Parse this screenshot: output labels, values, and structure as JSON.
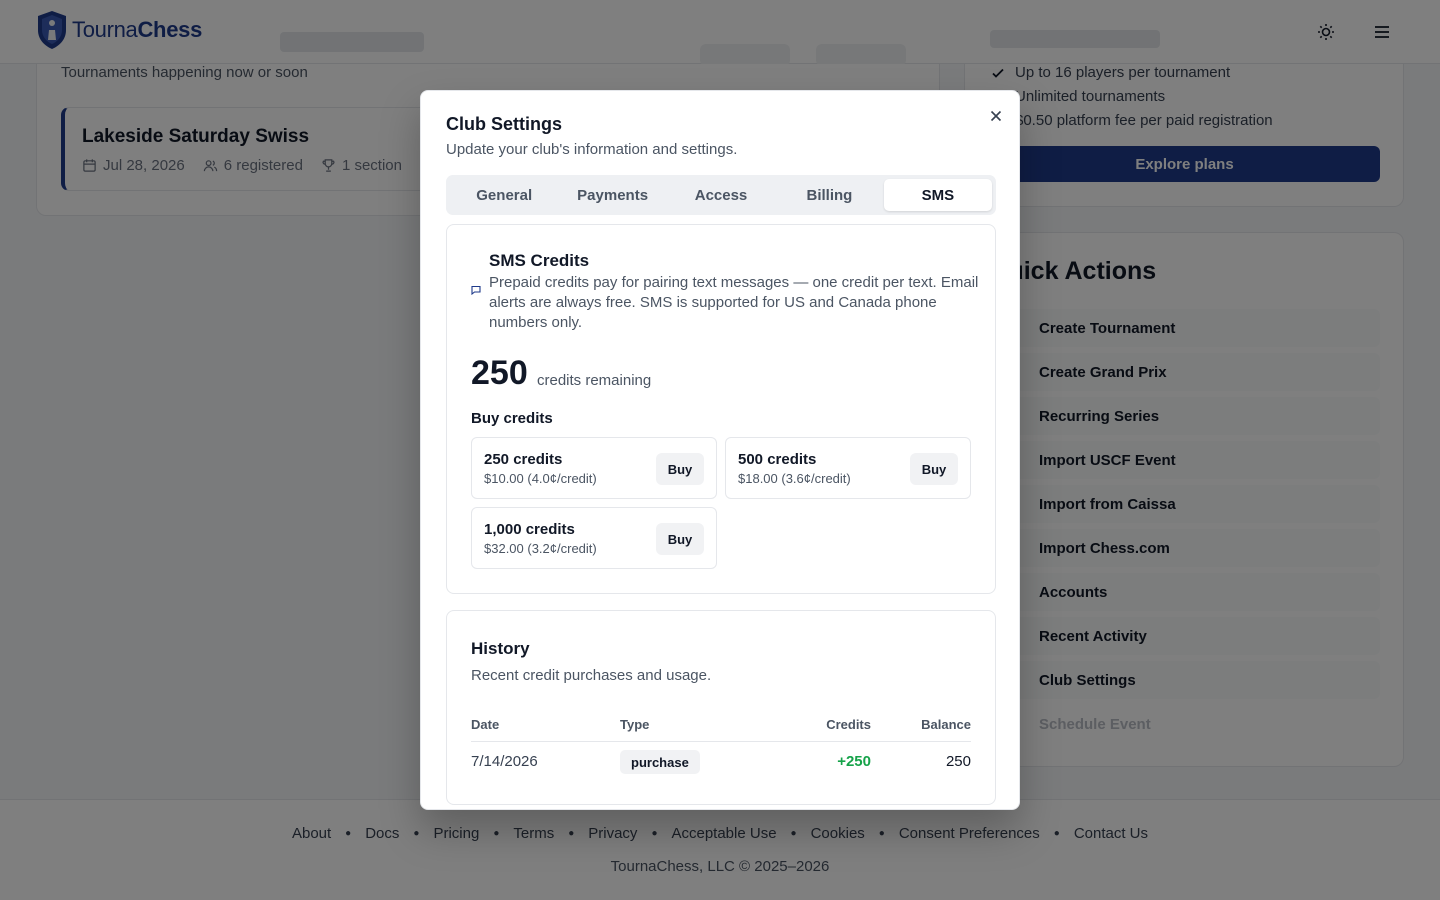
{
  "app": {
    "logo_text_part1": "Tourna",
    "logo_text_part2": "Chess"
  },
  "background": {
    "tournaments_subtitle": "Tournaments happening now or soon",
    "tournament": {
      "name": "Lakeside Saturday Swiss",
      "date": "Jul 28, 2026",
      "registered": "6 registered",
      "sections": "1 section"
    },
    "plan_features": [
      "Up to 16 players per tournament",
      "Unlimited tournaments",
      "$0.50 platform fee per paid registration"
    ],
    "plan_button": "Explore plans",
    "quick_actions_title": "Quick Actions",
    "quick_actions": [
      "Create Tournament",
      "Create Grand Prix",
      "Recurring Series",
      "Import USCF Event",
      "Import from Caissa",
      "Import Chess.com",
      "Accounts",
      "Recent Activity",
      "Club Settings",
      "Schedule Event"
    ]
  },
  "footer": {
    "links": [
      "About",
      "Docs",
      "Pricing",
      "Terms",
      "Privacy",
      "Acceptable Use",
      "Cookies",
      "Consent Preferences",
      "Contact Us"
    ],
    "copyright": "TournaChess, LLC © 2025–2026"
  },
  "modal": {
    "title": "Club Settings",
    "description": "Update your club's information and settings.",
    "tabs": [
      "General",
      "Payments",
      "Access",
      "Billing",
      "SMS"
    ],
    "active_tab": "SMS",
    "sms": {
      "heading": "SMS Credits",
      "text": "Prepaid credits pay for pairing text messages — one credit per text. Email alerts are always free. SMS is supported for US and Canada phone numbers only.",
      "credits_remaining": "250",
      "credits_label": "credits remaining",
      "buy_title": "Buy credits",
      "packages": [
        {
          "name": "250 credits",
          "price": "$10.00 (4.0¢/credit)",
          "button": "Buy"
        },
        {
          "name": "500 credits",
          "price": "$18.00 (3.6¢/credit)",
          "button": "Buy"
        },
        {
          "name": "1,000 credits",
          "price": "$32.00 (3.2¢/credit)",
          "button": "Buy"
        }
      ]
    },
    "history": {
      "title": "History",
      "description": "Recent credit purchases and usage.",
      "columns": [
        "Date",
        "Type",
        "Credits",
        "Balance"
      ],
      "rows": [
        {
          "date": "7/14/2026",
          "type": "purchase",
          "credits": "+250",
          "balance": "250"
        }
      ]
    }
  },
  "colors": {
    "brand": "#1e3a8a",
    "positive": "#16a34a",
    "overlay": "rgba(0,0,0,0.5)"
  }
}
